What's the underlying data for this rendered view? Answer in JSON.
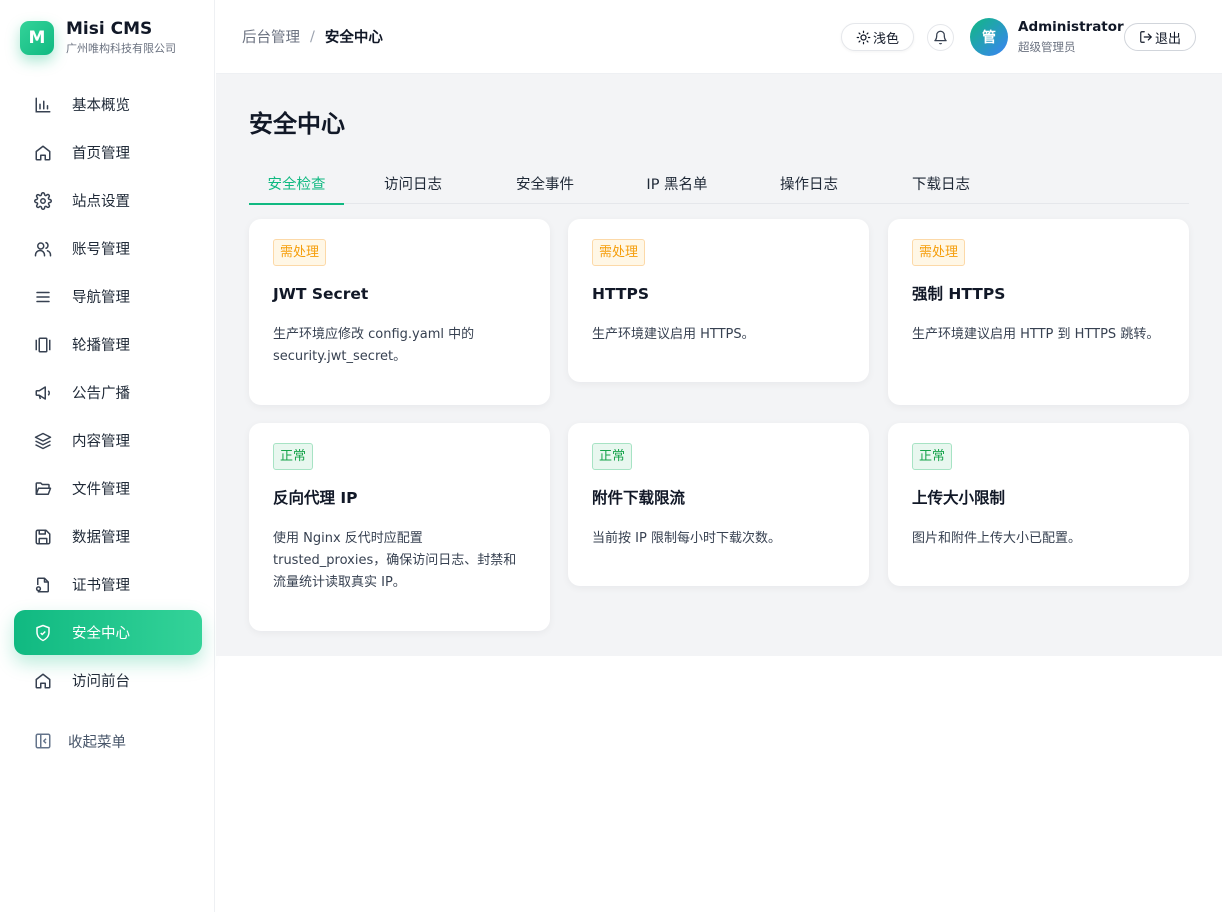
{
  "brand": {
    "logo_letter": "M",
    "name": "Misi CMS",
    "company": "广州唯构科技有限公司"
  },
  "sidebar": {
    "items": [
      {
        "label": "基本概览",
        "icon": "bar-chart-icon"
      },
      {
        "label": "首页管理",
        "icon": "home-icon"
      },
      {
        "label": "站点设置",
        "icon": "gear-icon"
      },
      {
        "label": "账号管理",
        "icon": "users-icon"
      },
      {
        "label": "导航管理",
        "icon": "menu-icon"
      },
      {
        "label": "轮播管理",
        "icon": "carousel-icon"
      },
      {
        "label": "公告广播",
        "icon": "megaphone-icon"
      },
      {
        "label": "内容管理",
        "icon": "layers-icon"
      },
      {
        "label": "文件管理",
        "icon": "folder-open-icon"
      },
      {
        "label": "数据管理",
        "icon": "save-icon"
      },
      {
        "label": "证书管理",
        "icon": "file-key-icon"
      },
      {
        "label": "安全中心",
        "icon": "shield-icon",
        "active": true
      },
      {
        "label": "访问前台",
        "icon": "home-icon"
      }
    ],
    "collapse_label": "收起菜单"
  },
  "header": {
    "breadcrumb": {
      "root": "后台管理",
      "separator": "/",
      "current": "安全中心"
    },
    "theme_label": "浅色",
    "user": {
      "avatar_text": "管",
      "name": "Administrator",
      "role": "超级管理员"
    },
    "logout_label": "退出"
  },
  "main": {
    "title": "安全中心",
    "tabs": [
      {
        "label": "安全检查",
        "active": true
      },
      {
        "label": "访问日志"
      },
      {
        "label": "安全事件"
      },
      {
        "label": "IP 黑名单"
      },
      {
        "label": "操作日志"
      },
      {
        "label": "下载日志"
      }
    ],
    "cards": [
      {
        "status": "需处理",
        "status_type": "warn",
        "title": "JWT Secret",
        "desc": "生产环境应修改 config.yaml 中的 security.jwt_secret。"
      },
      {
        "status": "需处理",
        "status_type": "warn",
        "title": "HTTPS",
        "desc": "生产环境建议启用 HTTPS。"
      },
      {
        "status": "需处理",
        "status_type": "warn",
        "title": "强制 HTTPS",
        "desc": "生产环境建议启用 HTTP 到 HTTPS 跳转。"
      },
      {
        "status": "正常",
        "status_type": "ok",
        "title": "反向代理 IP",
        "desc": "使用 Nginx 反代时应配置 trusted_proxies，确保访问日志、封禁和流量统计读取真实 IP。"
      },
      {
        "status": "正常",
        "status_type": "ok",
        "title": "附件下载限流",
        "desc": "当前按 IP 限制每小时下载次数。"
      },
      {
        "status": "正常",
        "status_type": "ok",
        "title": "上传大小限制",
        "desc": "图片和附件上传大小已配置。"
      }
    ]
  },
  "colors": {
    "accent": "#10b981",
    "warn": "#f59e0b",
    "ok": "#16a34a"
  }
}
